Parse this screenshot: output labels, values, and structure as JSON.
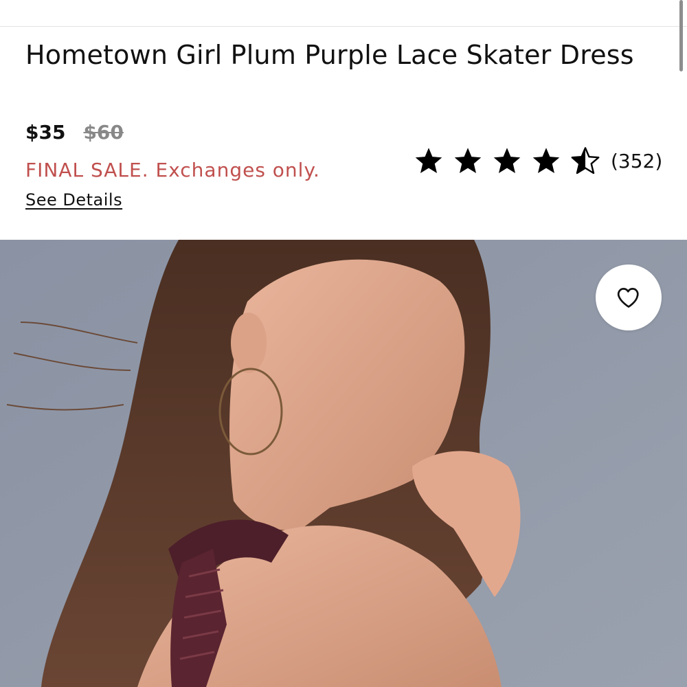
{
  "product": {
    "title": "Hometown Girl Plum Purple Lace Skater Dress",
    "price_current": "$35",
    "price_original": "$60",
    "sale_notice": "FINAL SALE. Exchanges only.",
    "details_link": "See Details"
  },
  "rating": {
    "stars": 4.5,
    "max_stars": 5,
    "count_text": "(352)"
  },
  "image": {
    "icons": [
      "heart-icon"
    ]
  },
  "colors": {
    "sale_red": "#c0504e",
    "strike_gray": "#888888",
    "photo_bg": "#8f96a5"
  }
}
